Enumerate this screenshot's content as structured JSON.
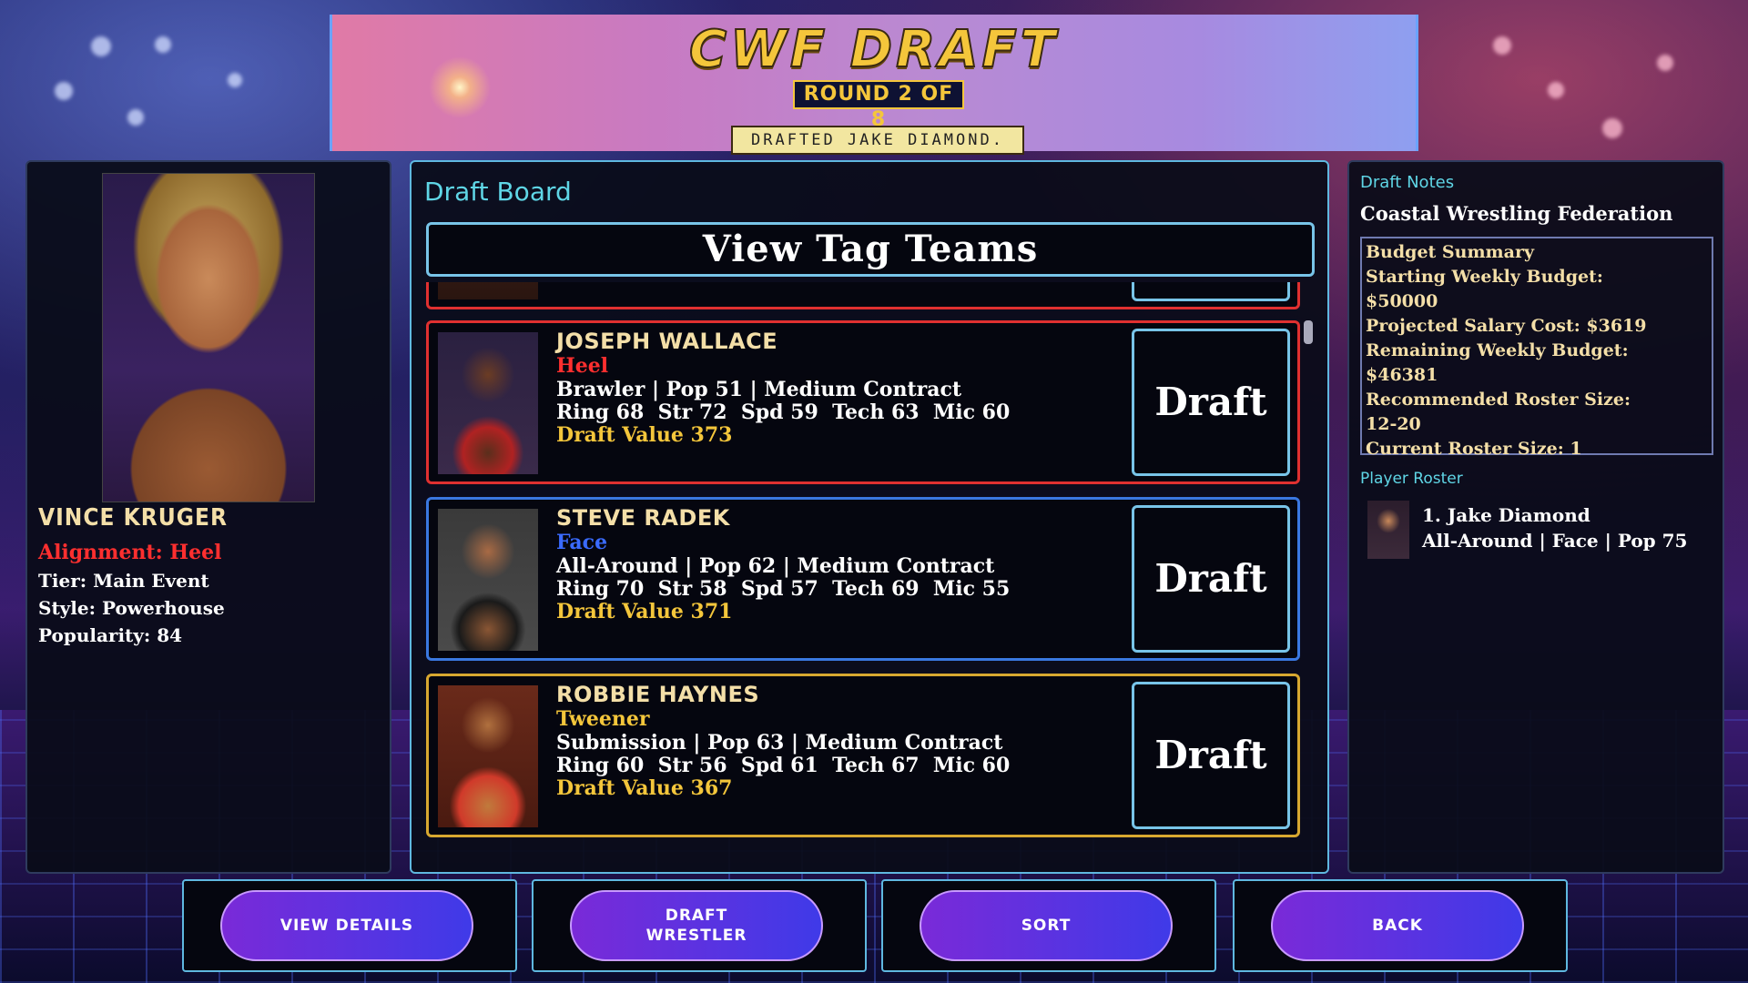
{
  "header": {
    "title": "CWF DRAFT",
    "round": "ROUND 2 OF 8",
    "status": "DRAFTED JAKE DIAMOND."
  },
  "selected": {
    "name": "VINCE KRUGER",
    "alignment": "Alignment: Heel",
    "tier": "Tier: Main Event",
    "style": "Style: Powerhouse",
    "popularity": "Popularity: 84"
  },
  "board": {
    "title": "Draft Board",
    "tag_teams_label": "View Tag Teams",
    "draft_label": "Draft",
    "cards": [
      {
        "name": "JOSEPH WALLACE",
        "alignment": "Heel",
        "alignment_color": "#ff2f2f",
        "border_color": "#e03030",
        "info": "Brawler | Pop 51 | Medium Contract",
        "stats": "Ring 68  Str 72  Spd 59  Tech 63  Mic 60",
        "value": "Draft Value 373"
      },
      {
        "name": "STEVE RADEK",
        "alignment": "Face",
        "alignment_color": "#3a6bff",
        "border_color": "#3a78e0",
        "info": "All-Around | Pop 62 | Medium Contract",
        "stats": "Ring 70  Str 58  Spd 57  Tech 69  Mic 55",
        "value": "Draft Value 371"
      },
      {
        "name": "ROBBIE HAYNES",
        "alignment": "Tweener",
        "alignment_color": "#f4c63b",
        "border_color": "#d8a830",
        "info": "Submission | Pop 63 | Medium Contract",
        "stats": "Ring 60  Str 56  Spd 61  Tech 67  Mic 60",
        "value": "Draft Value 367"
      }
    ]
  },
  "notes": {
    "title": "Draft Notes",
    "federation": "Coastal Wrestling Federation",
    "budget": {
      "heading": "Budget Summary",
      "starting_label": "Starting Weekly Budget:",
      "starting_value": "$50000",
      "projected": "Projected Salary Cost: $3619",
      "remaining_label": "Remaining Weekly Budget:",
      "remaining_value": "$46381",
      "recommended_label": "Recommended Roster Size:",
      "recommended_value": "12-20",
      "current": "Current Roster Size: 1"
    },
    "roster_title": "Player Roster",
    "roster": [
      {
        "line1": "1. Jake Diamond",
        "line2": "All-Around | Face | Pop 75"
      }
    ]
  },
  "buttons": {
    "view_details": "VIEW DETAILS",
    "draft_line1": "DRAFT",
    "draft_line2": "WRESTLER",
    "sort": "SORT",
    "back": "BACK"
  }
}
